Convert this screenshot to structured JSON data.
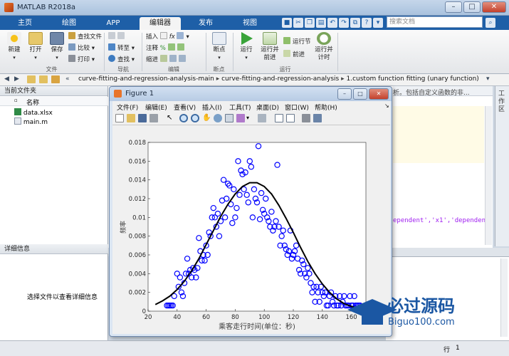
{
  "window": {
    "title": "MATLAB R2018a"
  },
  "tabs": [
    {
      "label": "主页",
      "active": false
    },
    {
      "label": "绘图",
      "active": false
    },
    {
      "label": "APP",
      "active": false
    },
    {
      "label": "编辑器",
      "active": true
    },
    {
      "label": "发布",
      "active": false
    },
    {
      "label": "视图",
      "active": false
    }
  ],
  "search": {
    "placeholder": "搜索文档"
  },
  "ribbon": {
    "file": {
      "new": "新建",
      "open": "打开",
      "save": "保存",
      "find_files": "查找文件",
      "compare": "比较",
      "print": "打印",
      "group": "文件"
    },
    "nav": {
      "goto": "转至",
      "find": "查找",
      "group": "导航"
    },
    "edit": {
      "insert": "插入",
      "comment": "注释",
      "indent": "缩进",
      "group": "编辑"
    },
    "breakpoints": {
      "label": "断点",
      "group": "断点"
    },
    "run": {
      "run": "运行",
      "run_advance": "运行并前进",
      "run_section": "运行节",
      "advance": "前进",
      "run_time": "运行并计时",
      "group": "运行"
    }
  },
  "address": {
    "prefix": "«",
    "path": [
      "curve-fitting-and-regression-analysis-main",
      "curve-fitting-and-regression-analysis",
      "1.custom function fitting (unary function)"
    ]
  },
  "left_panel": {
    "title": "当前文件夹",
    "column": "名称",
    "files": [
      {
        "name": "data.xlsx",
        "type": "xlsx"
      },
      {
        "name": "main.m",
        "type": "m"
      }
    ],
    "details_title": "详细信息",
    "details_hint": "选择文件以查看详细信息"
  },
  "editor": {
    "banner_text": "析。包括自定义函数的非...",
    "code_snippet": "ependent','x1','dependent'"
  },
  "right_tab": {
    "label": "工作区"
  },
  "status": {
    "row_label": "行",
    "row_value": "1"
  },
  "figure": {
    "title": "Figure 1",
    "menus": [
      "文件(F)",
      "编辑(E)",
      "查看(V)",
      "插入(I)",
      "工具(T)",
      "桌面(D)",
      "窗口(W)",
      "帮助(H)"
    ]
  },
  "chart_data": {
    "type": "scatter",
    "xlabel": "乘客走行时间(单位：秒)",
    "ylabel": "频率",
    "xlim": [
      20,
      170
    ],
    "ylim": [
      0,
      0.018
    ],
    "xticks": [
      "20",
      "40",
      "60",
      "80",
      "100",
      "120",
      "140",
      "160"
    ],
    "yticks": [
      "0",
      "0.002",
      "0.004",
      "0.006",
      "0.008",
      "0.01",
      "0.012",
      "0.014",
      "0.016",
      "0.018"
    ],
    "colors": {
      "scatter": "#0000ff",
      "curve": "#000000"
    },
    "series": [
      {
        "kind": "markers",
        "x": [
          33,
          34,
          35,
          36,
          37,
          38,
          40,
          41,
          42,
          43,
          44,
          45,
          46,
          47,
          48,
          49,
          50,
          51,
          52,
          53,
          54,
          55,
          56,
          57,
          58,
          59,
          60,
          61,
          62,
          63,
          64,
          65,
          66,
          67,
          68,
          69,
          70,
          71,
          72,
          73,
          74,
          75,
          76,
          77,
          78,
          79,
          80,
          81,
          82,
          83,
          84,
          85,
          86,
          87,
          88,
          89,
          90,
          91,
          92,
          93,
          94,
          95,
          96,
          97,
          98,
          99,
          100,
          101,
          102,
          103,
          104,
          105,
          106,
          107,
          108,
          109,
          110,
          111,
          112,
          113,
          114,
          115,
          116,
          117,
          118,
          119,
          120,
          121,
          122,
          123,
          124,
          125,
          126,
          127,
          128,
          129,
          130,
          131,
          132,
          133,
          134,
          135,
          136,
          137,
          138,
          139,
          140,
          141,
          142,
          143,
          144,
          145,
          146,
          147,
          148,
          149,
          150,
          151,
          152,
          153,
          154,
          155,
          156,
          157,
          158,
          159,
          160,
          161,
          162,
          163,
          164,
          165,
          166
        ],
        "y": [
          0.0006,
          0.0006,
          0.0006,
          0.0006,
          0.0006,
          0.0016,
          0.004,
          0.0026,
          0.0036,
          0.002,
          0.0016,
          0.003,
          0.004,
          0.0056,
          0.004,
          0.0044,
          0.0036,
          0.0046,
          0.0044,
          0.0036,
          0.0046,
          0.0078,
          0.0064,
          0.0054,
          0.006,
          0.0054,
          0.007,
          0.006,
          0.0084,
          0.008,
          0.01,
          0.011,
          0.01,
          0.009,
          0.0104,
          0.008,
          0.0096,
          0.0118,
          0.014,
          0.01,
          0.012,
          0.0136,
          0.0134,
          0.0114,
          0.0094,
          0.013,
          0.01,
          0.011,
          0.016,
          0.0124,
          0.015,
          0.0146,
          0.013,
          0.0148,
          0.0124,
          0.0116,
          0.016,
          0.0154,
          0.01,
          0.013,
          0.012,
          0.0116,
          0.0176,
          0.0098,
          0.0126,
          0.0108,
          0.0104,
          0.012,
          0.01,
          0.0096,
          0.009,
          0.0106,
          0.0086,
          0.009,
          0.0096,
          0.0156,
          0.009,
          0.007,
          0.008,
          0.0086,
          0.007,
          0.0066,
          0.006,
          0.0064,
          0.0086,
          0.0056,
          0.006,
          0.0064,
          0.007,
          0.0056,
          0.0044,
          0.004,
          0.0054,
          0.005,
          0.004,
          0.0036,
          0.0046,
          0.004,
          0.003,
          0.002,
          0.0026,
          0.001,
          0.0026,
          0.002,
          0.001,
          0.0026,
          0.002,
          0.0016,
          0.002,
          0.0006,
          0.0006,
          0.0016,
          0.002,
          0.001,
          0.0006,
          0.0016,
          0.0006,
          0.0006,
          0.0016,
          0.0006,
          0.001,
          0.0016,
          0.0006,
          0.0006,
          0.0006,
          0.0016,
          0.0006,
          0.0006,
          0.0016,
          0.0006,
          0.0006,
          0.0006,
          0.0006
        ]
      },
      {
        "kind": "curve",
        "x": [
          25,
          30,
          35,
          40,
          45,
          50,
          55,
          60,
          65,
          70,
          75,
          80,
          85,
          90,
          95,
          100,
          105,
          110,
          115,
          120,
          125,
          130,
          135,
          140,
          145,
          150,
          155,
          160,
          165
        ],
        "y": [
          0.0007,
          0.0011,
          0.0016,
          0.0023,
          0.0032,
          0.0043,
          0.0056,
          0.0071,
          0.0086,
          0.0101,
          0.0114,
          0.0125,
          0.0133,
          0.0137,
          0.0137,
          0.0133,
          0.0125,
          0.0113,
          0.0099,
          0.0084,
          0.0068,
          0.0053,
          0.004,
          0.0029,
          0.002,
          0.0013,
          0.0008,
          0.0005,
          0.0003
        ]
      }
    ]
  },
  "watermark": {
    "title": "必过源码",
    "url": "Biguo100.com"
  }
}
